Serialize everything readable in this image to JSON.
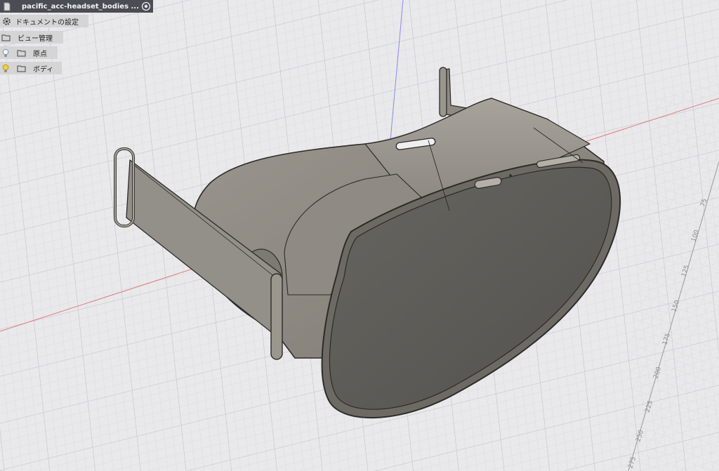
{
  "browser": {
    "document_tab": {
      "title": "pacific_acc-headset_bodies ...",
      "doc_icon": "document-icon",
      "radio_icon": "radio-target-icon"
    },
    "items": [
      {
        "label": "ドキュメントの設定",
        "icon": "gear-icon"
      },
      {
        "label": "ビュー管理",
        "icon": "folder-icon"
      },
      {
        "label": "原点",
        "icon": "folder-icon",
        "visibility_icon": "lightbulb-off-icon"
      },
      {
        "label": "ボディ",
        "icon": "folder-icon",
        "visibility_icon": "lightbulb-on-icon"
      }
    ]
  },
  "ruler": {
    "ticks": [
      "75",
      "100",
      "125",
      "150",
      "175",
      "200",
      "225",
      "250",
      "275"
    ]
  },
  "colors": {
    "grid_background": "#e9e9eb",
    "grid_line": "#cfd0d4",
    "axis_red": "#e07a7a",
    "axis_blue": "#8a8ae6",
    "model_body": "#8e8a82",
    "model_face": "#5f5d58",
    "highlight_bulb": "#f2d13a"
  }
}
